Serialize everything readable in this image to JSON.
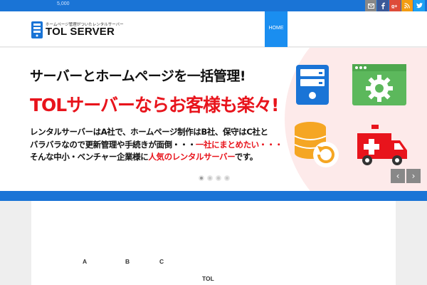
{
  "topbar": {
    "phone": "5,000",
    "social": [
      {
        "icon": "mail-icon",
        "bg": "#888888"
      },
      {
        "icon": "facebook-icon",
        "bg": "#3b5998"
      },
      {
        "icon": "googleplus-icon",
        "bg": "#dd4b39"
      },
      {
        "icon": "rss-icon",
        "bg": "#f39c12"
      },
      {
        "icon": "twitter-icon",
        "bg": "#1da1f2"
      }
    ]
  },
  "header": {
    "tagline": "ホームページ管理がついたレンタルサーバー",
    "brand": "TOL SERVER",
    "nav_home": "HOME"
  },
  "hero": {
    "headline": "サーバーとホームページを一括管理!",
    "subheadline": "TOLサーバーならお客様も楽々!",
    "body_line1": "レンタルサーバーはA社で、ホームページ制作はB社、保守はC社と",
    "body_line2a": "バラバラなので更新管理や手続きが面倒・・・",
    "body_line2b": "一社にまとめたい・・・",
    "body_line3a": "そんな中小・ベンチャー企業様に",
    "body_line3b": "人気のレンタルサーバー",
    "body_line3c": "です。",
    "prev": "‹",
    "next": "›",
    "slides": 4,
    "active_slide": 0
  },
  "content": {
    "col_a": "A",
    "col_b": "B",
    "col_c": "C",
    "footer_label": "TOL"
  },
  "colors": {
    "accent": "#1a74d6",
    "red": "#e8141c",
    "nav_active": "#1a8ef0"
  }
}
